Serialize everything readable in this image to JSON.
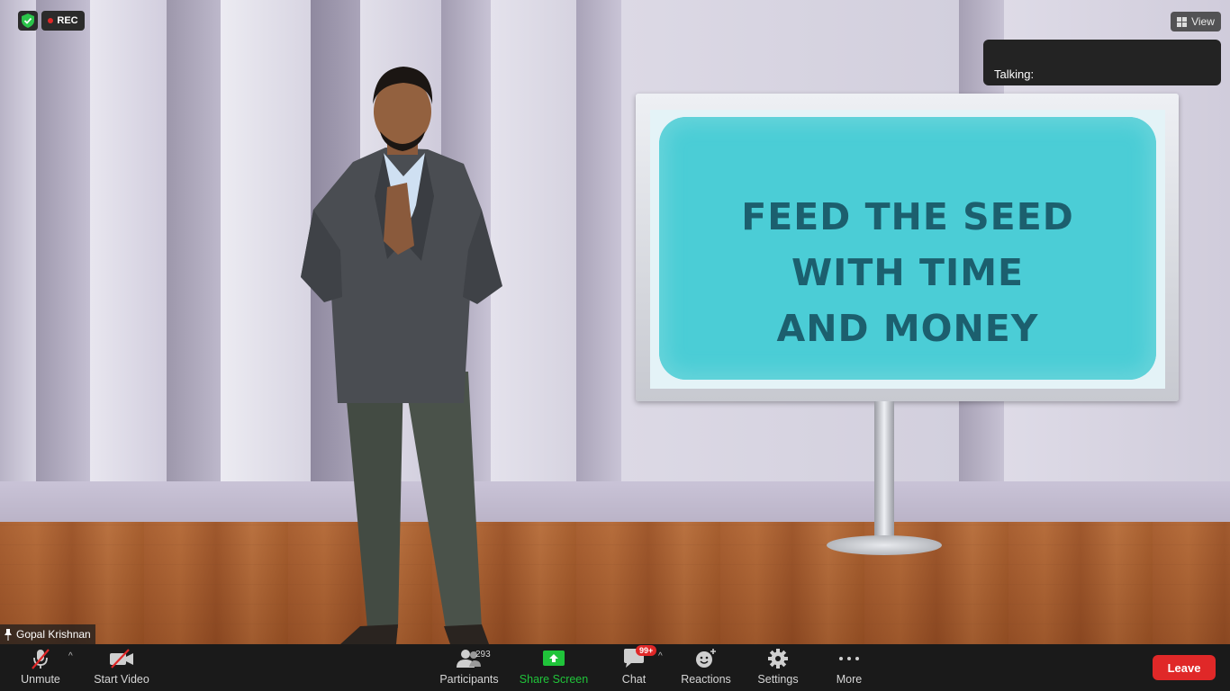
{
  "recording": {
    "label": "REC"
  },
  "view_button": {
    "label": "View"
  },
  "talking_panel": {
    "text": "Talking:"
  },
  "slide": {
    "lines": [
      "FEED THE SEED",
      "WITH TIME",
      "AND MONEY"
    ]
  },
  "participant": {
    "name": "Gopal Krishnan"
  },
  "toolbar": {
    "unmute": "Unmute",
    "start_video": "Start Video",
    "participants": "Participants",
    "participants_count": "293",
    "share_screen": "Share Screen",
    "chat": "Chat",
    "chat_badge": "99+",
    "reactions": "Reactions",
    "settings": "Settings",
    "more": "More",
    "leave": "Leave"
  },
  "icons": {
    "security": "shield-icon",
    "recording": "record-dot-icon",
    "view": "grid-icon",
    "pin": "pin-icon",
    "mic_muted": "mic-muted-icon",
    "video_off": "video-off-icon",
    "participants": "participants-icon",
    "share": "share-screen-icon",
    "chat": "chat-icon",
    "reactions": "reactions-icon",
    "settings": "gear-icon",
    "more": "more-icon"
  },
  "colors": {
    "leave": "#e02828",
    "share_screen": "#20c43a",
    "security_shield": "#2bc44a",
    "slide_paint": "#4bcdd6",
    "slide_text": "#1c5f6e"
  }
}
